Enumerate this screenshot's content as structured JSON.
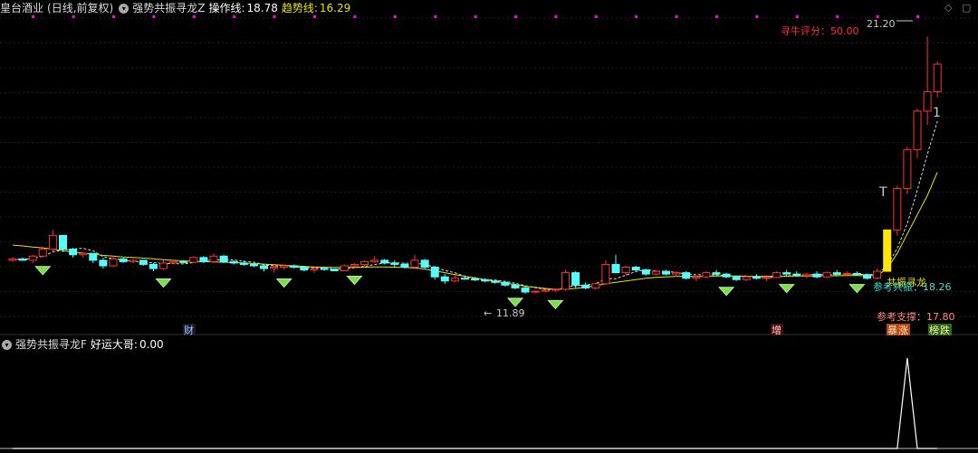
{
  "main_header": {
    "stock": "皇台酒业",
    "period": "(日线,前复权)",
    "indicator": "强势共振寻龙Z",
    "op_label": "操作线:",
    "op_value": "18.78",
    "trend_label": "趋势线:",
    "trend_value": "16.29"
  },
  "sub_header": {
    "indicator": "强势共振寻龙F",
    "label": "好运大哥:",
    "value": "0.00"
  },
  "annotations": {
    "score": "寻牛评分：50.00",
    "high": "21.20",
    "low": "11.89",
    "resonance": "共振寻龙",
    "ref_resonance": "参考共振：18.26",
    "ref_support": "参考支撑：17.80",
    "tag_cai": "财",
    "tag_zeng": "增",
    "tag_zhang": "涨",
    "tag_die": "跌",
    "tag_zhang_prefix": "暴",
    "tag_die_prefix": "榜",
    "mark_t": "T",
    "mark_1": "1"
  },
  "colors": {
    "up": "#ff3232",
    "down": "#54ffff",
    "trend": "#e6e600",
    "ma": "#ffffff",
    "signal": "#ffffff",
    "diamond": "#7ddc4a",
    "magenta": "#ff00ff"
  },
  "chart_data": [
    {
      "type": "candlestick",
      "title": "皇台酒业 (日线,前复权)",
      "ylim": [
        11.0,
        22.0
      ],
      "grid": true,
      "candles": [
        [
          13.1,
          13.2,
          13.05,
          13.15
        ],
        [
          13.15,
          13.2,
          13.1,
          13.1
        ],
        [
          13.1,
          13.3,
          13.0,
          13.25
        ],
        [
          13.25,
          13.6,
          13.2,
          13.5
        ],
        [
          13.5,
          14.2,
          13.4,
          14.0
        ],
        [
          14.0,
          14.0,
          13.4,
          13.5
        ],
        [
          13.5,
          13.55,
          13.2,
          13.3
        ],
        [
          13.3,
          13.4,
          13.2,
          13.35
        ],
        [
          13.35,
          13.35,
          13.0,
          13.1
        ],
        [
          13.1,
          13.2,
          12.8,
          12.9
        ],
        [
          12.9,
          13.25,
          12.85,
          13.15
        ],
        [
          13.15,
          13.2,
          13.0,
          13.05
        ],
        [
          13.05,
          13.15,
          13.0,
          13.1
        ],
        [
          13.1,
          13.1,
          12.9,
          12.95
        ],
        [
          12.95,
          13.0,
          12.7,
          12.8
        ],
        [
          12.8,
          13.1,
          12.75,
          13.0
        ],
        [
          13.0,
          13.1,
          12.95,
          13.05
        ],
        [
          13.05,
          13.1,
          13.0,
          13.03
        ],
        [
          13.03,
          13.25,
          13.0,
          13.2
        ],
        [
          13.2,
          13.25,
          13.0,
          13.05
        ],
        [
          13.05,
          13.35,
          13.0,
          13.25
        ],
        [
          13.25,
          13.3,
          13.0,
          13.05
        ],
        [
          13.05,
          13.1,
          12.95,
          13.0
        ],
        [
          13.0,
          13.1,
          12.9,
          12.95
        ],
        [
          12.95,
          13.0,
          12.85,
          12.9
        ],
        [
          12.9,
          12.95,
          12.7,
          12.8
        ],
        [
          12.8,
          12.9,
          12.65,
          12.85
        ],
        [
          12.85,
          12.95,
          12.75,
          12.9
        ],
        [
          12.9,
          12.95,
          12.8,
          12.85
        ],
        [
          12.85,
          12.9,
          12.7,
          12.75
        ],
        [
          12.75,
          12.85,
          12.65,
          12.8
        ],
        [
          12.8,
          12.85,
          12.72,
          12.78
        ],
        [
          12.78,
          12.8,
          12.7,
          12.72
        ],
        [
          12.72,
          12.95,
          12.7,
          12.9
        ],
        [
          12.9,
          13.0,
          12.85,
          12.95
        ],
        [
          12.95,
          13.1,
          12.9,
          13.05
        ],
        [
          13.05,
          13.25,
          13.0,
          13.1
        ],
        [
          13.1,
          13.15,
          12.95,
          13.0
        ],
        [
          13.0,
          13.1,
          12.85,
          12.95
        ],
        [
          12.95,
          13.0,
          12.8,
          12.85
        ],
        [
          12.85,
          13.3,
          12.8,
          13.1
        ],
        [
          13.1,
          13.15,
          12.8,
          12.85
        ],
        [
          12.85,
          12.9,
          12.4,
          12.5
        ],
        [
          12.5,
          12.6,
          12.25,
          12.35
        ],
        [
          12.35,
          12.55,
          12.3,
          12.45
        ],
        [
          12.45,
          12.55,
          12.4,
          12.42
        ],
        [
          12.42,
          12.5,
          12.35,
          12.4
        ],
        [
          12.4,
          12.45,
          12.3,
          12.35
        ],
        [
          12.35,
          12.4,
          12.25,
          12.3
        ],
        [
          12.3,
          12.35,
          12.15,
          12.2
        ],
        [
          12.2,
          12.25,
          12.05,
          12.1
        ],
        [
          12.1,
          12.15,
          11.89,
          11.95
        ],
        [
          11.95,
          12.0,
          11.9,
          11.98
        ],
        [
          11.98,
          12.05,
          11.93,
          12.02
        ],
        [
          12.02,
          12.08,
          11.97,
          12.05
        ],
        [
          12.05,
          12.75,
          12.0,
          12.65
        ],
        [
          12.65,
          12.7,
          12.1,
          12.2
        ],
        [
          12.2,
          12.3,
          12.05,
          12.1
        ],
        [
          12.1,
          12.3,
          12.05,
          12.25
        ],
        [
          12.25,
          13.1,
          12.2,
          12.95
        ],
        [
          12.95,
          13.3,
          12.8,
          12.65
        ],
        [
          12.65,
          12.9,
          12.55,
          12.85
        ],
        [
          12.85,
          12.9,
          12.7,
          12.75
        ],
        [
          12.75,
          12.8,
          12.55,
          12.6
        ],
        [
          12.6,
          12.75,
          12.55,
          12.7
        ],
        [
          12.7,
          12.75,
          12.55,
          12.6
        ],
        [
          12.6,
          12.7,
          12.5,
          12.65
        ],
        [
          12.65,
          12.7,
          12.4,
          12.45
        ],
        [
          12.45,
          12.55,
          12.35,
          12.5
        ],
        [
          12.5,
          12.7,
          12.45,
          12.65
        ],
        [
          12.65,
          12.75,
          12.55,
          12.6
        ],
        [
          12.6,
          12.65,
          12.45,
          12.5
        ],
        [
          12.5,
          12.55,
          12.35,
          12.4
        ],
        [
          12.4,
          12.55,
          12.35,
          12.5
        ],
        [
          12.5,
          12.6,
          12.4,
          12.45
        ],
        [
          12.45,
          12.5,
          12.35,
          12.48
        ],
        [
          12.48,
          12.7,
          12.45,
          12.65
        ],
        [
          12.65,
          12.75,
          12.55,
          12.6
        ],
        [
          12.6,
          12.7,
          12.5,
          12.55
        ],
        [
          12.55,
          12.65,
          12.45,
          12.6
        ],
        [
          12.6,
          12.7,
          12.45,
          12.5
        ],
        [
          12.5,
          12.7,
          12.45,
          12.65
        ],
        [
          12.65,
          12.75,
          12.55,
          12.6
        ],
        [
          12.6,
          12.7,
          12.55,
          12.62
        ],
        [
          12.62,
          12.7,
          12.55,
          12.58
        ],
        [
          12.58,
          12.62,
          12.4,
          12.45
        ],
        [
          12.45,
          12.8,
          12.4,
          12.7
        ],
        [
          12.7,
          14.2,
          12.7,
          14.2
        ],
        [
          14.2,
          15.8,
          14.0,
          15.7
        ],
        [
          15.7,
          17.2,
          15.5,
          17.1
        ],
        [
          17.1,
          18.6,
          16.8,
          18.5
        ],
        [
          18.5,
          21.2,
          18.0,
          19.2
        ],
        [
          19.2,
          20.3,
          19.0,
          20.2
        ]
      ],
      "trend_line": [
        13.65,
        13.62,
        13.58,
        13.55,
        13.5,
        13.45,
        13.4,
        13.36,
        13.32,
        13.28,
        13.25,
        13.22,
        13.2,
        13.18,
        13.15,
        13.12,
        13.1,
        13.08,
        13.06,
        13.05,
        13.04,
        13.03,
        13.02,
        13.0,
        12.98,
        12.96,
        12.94,
        12.92,
        12.9,
        12.88,
        12.86,
        12.85,
        12.84,
        12.84,
        12.84,
        12.85,
        12.86,
        12.86,
        12.85,
        12.84,
        12.82,
        12.78,
        12.72,
        12.65,
        12.58,
        12.52,
        12.46,
        12.4,
        12.34,
        12.28,
        12.22,
        12.16,
        12.12,
        12.08,
        12.05,
        12.05,
        12.08,
        12.12,
        12.18,
        12.25,
        12.3,
        12.35,
        12.4,
        12.45,
        12.48,
        12.5,
        12.52,
        12.52,
        12.52,
        12.52,
        12.53,
        12.53,
        12.53,
        12.52,
        12.52,
        12.52,
        12.52,
        12.52,
        12.53,
        12.53,
        12.53,
        12.54,
        12.54,
        12.55,
        12.55,
        12.54,
        12.55,
        12.8,
        13.35,
        14.05,
        14.75,
        15.45,
        16.29
      ]
    },
    {
      "type": "line",
      "title": "强势共振寻龙F",
      "series": [
        {
          "name": "好运大哥",
          "values": [
            0,
            0,
            0,
            0,
            0,
            0,
            0,
            0,
            0,
            0,
            0,
            0,
            0,
            0,
            0,
            0,
            0,
            0,
            0,
            0,
            0,
            0,
            0,
            0,
            0,
            0,
            0,
            0,
            0,
            0,
            0,
            0,
            0,
            0,
            0,
            0,
            0,
            0,
            0,
            0,
            0,
            0,
            0,
            0,
            0,
            0,
            0,
            0,
            0,
            0,
            0,
            0,
            0,
            0,
            0,
            0,
            0,
            0,
            0,
            0,
            0,
            0,
            0,
            0,
            0,
            0,
            0,
            0,
            0,
            0,
            0,
            0,
            0,
            0,
            0,
            0,
            0,
            0,
            0,
            0,
            0,
            0,
            0,
            0,
            0,
            0,
            0,
            0,
            0,
            1,
            0,
            0,
            0
          ]
        }
      ]
    }
  ]
}
